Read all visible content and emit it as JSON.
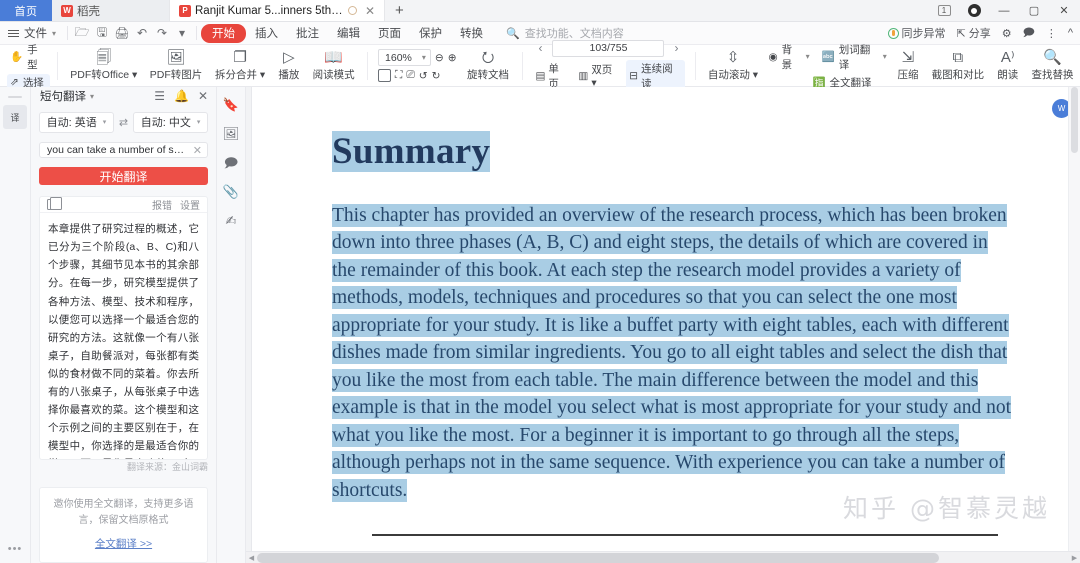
{
  "window": {
    "home_tab": "首页",
    "tabs": [
      {
        "label": "稻壳",
        "icon": "wps-dock-icon",
        "active": false
      },
      {
        "label": "Ranjit Kumar 5...inners 5th.pdf",
        "icon": "pdf-icon",
        "active": true
      }
    ],
    "new_tab": "+",
    "controls": {
      "badge": "1",
      "record": "record-icon",
      "minimize": "—",
      "maximize": "▢",
      "close": "✕"
    }
  },
  "menubar": {
    "file": "文件",
    "quick_icons": [
      "open-icon",
      "save-icon",
      "print-icon",
      "undo-icon",
      "redo-icon",
      "customize-icon"
    ],
    "tabs": [
      {
        "label": "开始",
        "active": true
      },
      {
        "label": "插入",
        "active": false
      },
      {
        "label": "批注",
        "active": false
      },
      {
        "label": "编辑",
        "active": false
      },
      {
        "label": "页面",
        "active": false
      },
      {
        "label": "保护",
        "active": false
      },
      {
        "label": "转换",
        "active": false
      }
    ],
    "search_placeholder": "查找功能、文档内容",
    "right": {
      "sync": "同步异常",
      "share": "分享",
      "settings": "gear-icon",
      "feedback": "comment-icon",
      "more": "⋮",
      "collapse": "^"
    }
  },
  "ribbon": {
    "hand_tool": "手型",
    "select_tool": "选择",
    "buttons": [
      {
        "label": "PDF转Office",
        "icon": "pdf-to-office-icon",
        "dropdown": true
      },
      {
        "label": "PDF转图片",
        "icon": "pdf-to-image-icon",
        "dropdown": false
      },
      {
        "label": "拆分合并",
        "icon": "split-merge-icon",
        "dropdown": true
      },
      {
        "label": "播放",
        "icon": "play-icon",
        "dropdown": false
      },
      {
        "label": "阅读模式",
        "icon": "read-mode-icon",
        "dropdown": false
      }
    ],
    "zoom": {
      "value": "160%",
      "zoom_out": "zoom-out-icon",
      "zoom_in": "zoom-in-icon"
    },
    "fit_icons": [
      "fit-width-icon",
      "fit-page-icon",
      "fit-actual-icon",
      "rotate-left-icon",
      "rotate-right-icon"
    ],
    "rotate_doc": "旋转文档",
    "page_nav": {
      "prev": "‹",
      "value": "103/755",
      "next": "›"
    },
    "view_modes": [
      {
        "label": "单页",
        "icon": "single-page-icon",
        "dropdown": false,
        "active": false
      },
      {
        "label": "双页",
        "icon": "dual-page-icon",
        "dropdown": true,
        "active": false
      },
      {
        "label": "连续阅读",
        "icon": "continuous-scroll-icon",
        "dropdown": false,
        "active": true
      }
    ],
    "autoscroll": {
      "label": "自动滚动",
      "icon": "autoscroll-icon",
      "dropdown": true
    },
    "background": {
      "label": "背景",
      "icon": "eye-icon",
      "dropdown": true
    },
    "word_translate": {
      "label": "划词翻译",
      "icon": "word-translate-icon",
      "dropdown": true
    },
    "full_translate": {
      "label": "全文翻译",
      "icon": "full-translate-icon"
    },
    "compress": {
      "label": "压缩",
      "icon": "compress-icon"
    },
    "screenshot_compare": {
      "label": "截图和对比",
      "icon": "screenshot-compare-icon"
    },
    "read_aloud": {
      "label": "朗读",
      "icon": "read-aloud-icon"
    },
    "find_replace": {
      "label": "查找替换",
      "icon": "search-icon"
    }
  },
  "rail": {
    "translate_tool": "translate-panel-icon",
    "more": "•••"
  },
  "translate_panel": {
    "title": "短句翻译",
    "header_icons": [
      "list-icon",
      "bell-icon",
      "close-icon"
    ],
    "source_lang": "自动: 英语",
    "swap_icon": "swap-icon",
    "target_lang": "自动: 中文",
    "input_value": "you can take a number of shortcuts.",
    "clear_icon": "clear-icon",
    "translate_button": "开始翻译",
    "result_header": {
      "copy_icon": "copy-icon",
      "report": "报错",
      "settings": "设置"
    },
    "result_text": "本章提供了研究过程的概述，它已分为三个阶段(a、B、C)和八个步骤，其细节见本书的其余部分。在每一步，研究模型提供了各种方法、模型、技术和程序，以便您可以选择一个最适合您的研究的方法。这就像一个有八张桌子，自助餐派对，每张都有类似的食材做不同的菜着。你去所有的八张桌子，从每张桌子中选择你最喜欢的菜。这个模型和这个示例之间的主要区别在于，在模型中，你选择的是最适合你的学习，而不是你最喜欢的。对于一个初学者来说，完成所有的步骤是很重要的，尽管可能不是在相同的顺序中。有了经验，你可以采取许多快捷方式。",
    "source_label": "翻译来源：金山词霸",
    "promo_text": "邀你使用全文翻译，支持更多语言，保留文档原格式",
    "promo_link": "全文翻译 >>"
  },
  "doc_rail": {
    "icons": [
      "bookmark-icon",
      "thumbnail-icon",
      "comment-icon",
      "attachment-icon",
      "signature-icon"
    ]
  },
  "document": {
    "heading": "Summary",
    "paragraph": "This chapter has provided an overview of the research process, which has been broken down into three phases (A, B, C) and eight steps, the details of which are covered in the remainder of this book. At each step the research model provides a variety of methods, models, techniques and procedures so that you can select the one most appropriate for your study. It is like a buffet party with eight tables, each with different dishes made from similar ingredients. You go to all eight tables and select the dish that you like the most from each table. The main difference between the model and this example is that in the model you select what is most appropriate for your study and not what you like the most. For a beginner it is important to go through all the steps, although perhaps not in the same sequence. With experience you can take a number of shortcuts.",
    "watermark": "知乎 @智慕灵越",
    "selection_color": "#a9cde4",
    "text_color": "#27486c"
  },
  "floating": {
    "assistant_icon": "wps-assistant-icon"
  }
}
